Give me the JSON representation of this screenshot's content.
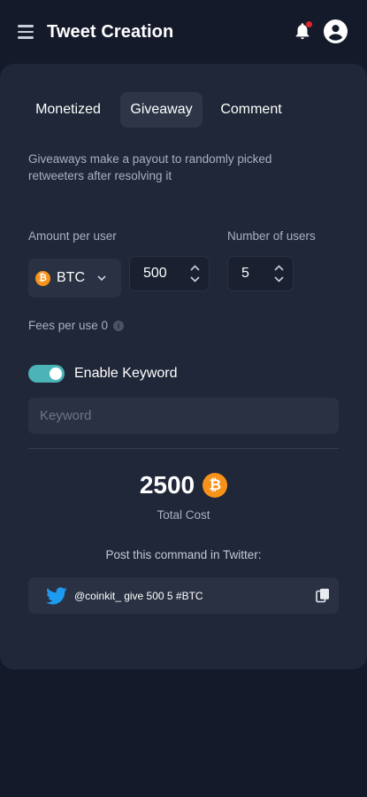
{
  "header": {
    "title": "Tweet Creation",
    "icons": [
      "menu-icon",
      "bell-icon",
      "account-icon"
    ],
    "notification_dot_color": "#e2262f"
  },
  "tabs": [
    {
      "label": "Monetized",
      "active": false
    },
    {
      "label": "Giveaway",
      "active": true
    },
    {
      "label": "Comment",
      "active": false
    }
  ],
  "description": "Giveaways make a payout to randomly picked retweeters after resolving it",
  "amount": {
    "label": "Amount per user",
    "currency": "BTC",
    "currency_icon": "bitcoin-icon",
    "value": "500"
  },
  "users": {
    "label": "Number of users",
    "value": "5"
  },
  "fees": {
    "label": "Fees per use 0"
  },
  "keyword": {
    "toggle_label": "Enable Keyword",
    "enabled": true,
    "placeholder": "Keyword",
    "value": ""
  },
  "total": {
    "amount": "2500",
    "label": "Total Cost"
  },
  "command": {
    "label": "Post this command in Twitter:",
    "text": "@coinkit_ give 500 5 #BTC"
  },
  "colors": {
    "background": "#141a2a",
    "card": "#202738",
    "accent_toggle": "#4bb4b8",
    "bitcoin": "#f7931a",
    "twitter": "#1d9bf0"
  }
}
